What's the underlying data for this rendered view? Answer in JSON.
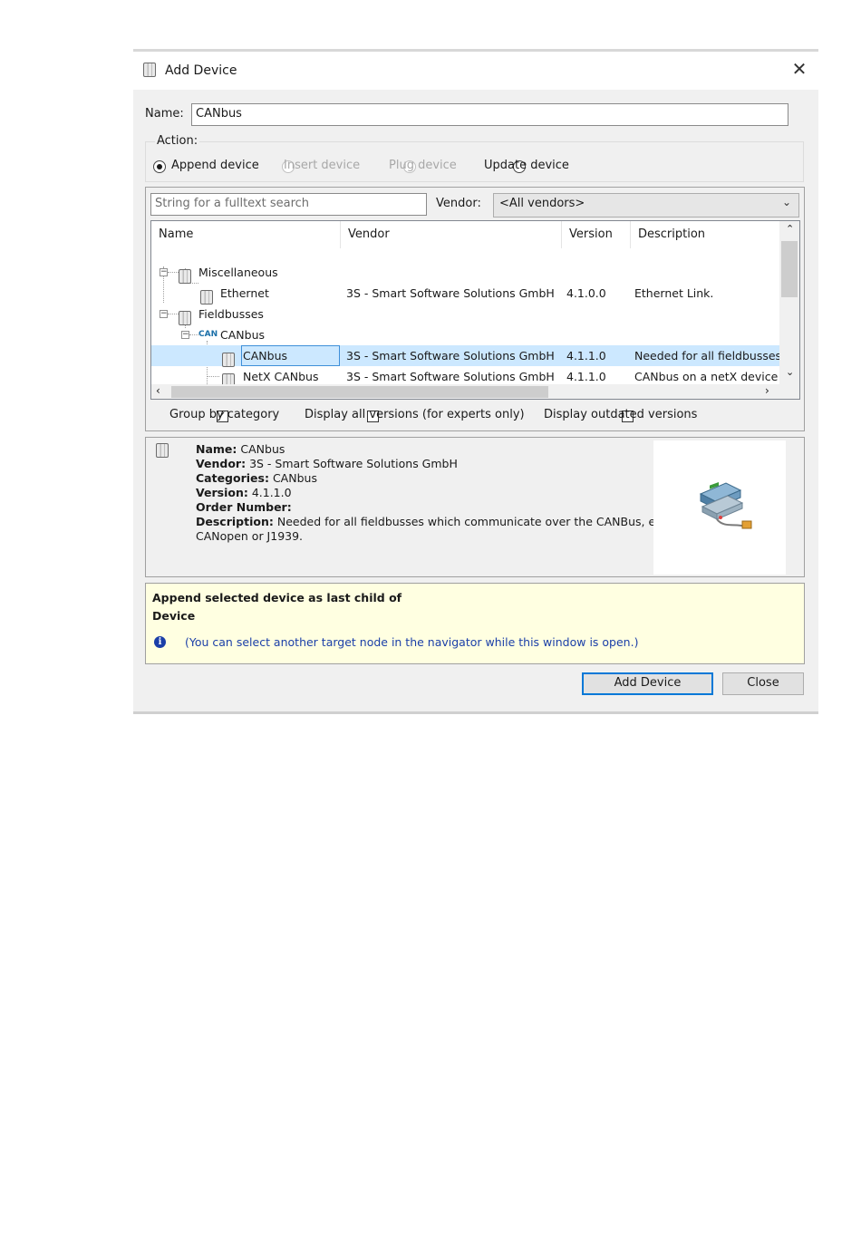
{
  "dialog": {
    "title": "Add Device",
    "close_glyph": "✕"
  },
  "name_field": {
    "label": "Name:",
    "value": "CANbus"
  },
  "action": {
    "label": "Action:",
    "options": [
      {
        "label": "Append device",
        "selected": true,
        "enabled": true
      },
      {
        "label": "Insert device",
        "selected": false,
        "enabled": false
      },
      {
        "label": "Plug device",
        "selected": false,
        "enabled": false
      },
      {
        "label": "Update device",
        "selected": false,
        "enabled": true
      }
    ]
  },
  "search": {
    "placeholder": "String for a fulltext search"
  },
  "vendor": {
    "label": "Vendor:",
    "selected": "<All vendors>"
  },
  "table": {
    "columns": [
      "Name",
      "Vendor",
      "Version",
      "Description"
    ],
    "rows": [
      {
        "name": "Miscellaneous",
        "vendor": "",
        "version": "",
        "description": ""
      },
      {
        "name": "Ethernet",
        "vendor": "3S - Smart Software Solutions GmbH",
        "version": "4.1.0.0",
        "description": "Ethernet Link."
      },
      {
        "name": "Fieldbusses",
        "vendor": "",
        "version": "",
        "description": ""
      },
      {
        "name": "CANbus",
        "badge": "CAN",
        "vendor": "",
        "version": "",
        "description": ""
      },
      {
        "name": "CANbus",
        "vendor": "3S - Smart Software Solutions GmbH",
        "version": "4.1.1.0",
        "description": "Needed for all fieldbusses w",
        "selected": true
      },
      {
        "name": "NetX CANbus",
        "vendor": "3S - Smart Software Solutions GmbH",
        "version": "4.1.1.0",
        "description": "CANbus on a netX device"
      }
    ]
  },
  "options": {
    "group_by_category": {
      "label": "Group by category",
      "checked": true
    },
    "display_all_versions": {
      "label": "Display all versions (for experts only)",
      "checked": false
    },
    "display_outdated": {
      "label": "Display outdated versions",
      "checked": false
    }
  },
  "info": {
    "name_key": "Name:",
    "name_val": "CANbus",
    "vendor_key": "Vendor:",
    "vendor_val": "3S - Smart Software Solutions GmbH",
    "categories_key": "Categories:",
    "categories_val": "CANbus",
    "version_key": "Version:",
    "version_val": "4.1.1.0",
    "order_key": "Order Number:",
    "order_val": "",
    "description_key": "Description:",
    "description_val": "Needed for all fieldbusses which communicate over the CANBus, e.g.",
    "description_val2": "CANopen or J1939."
  },
  "notice": {
    "line1": "Append selected device as last child of",
    "line2": "Device",
    "hint": "(You can select another target node in the navigator while this window is open.)"
  },
  "buttons": {
    "add": "Add Device",
    "close": "Close"
  },
  "colors": {
    "selection": "#cce8ff",
    "notice_bg": "#ffffe1",
    "default_button_border": "#0078d7"
  }
}
